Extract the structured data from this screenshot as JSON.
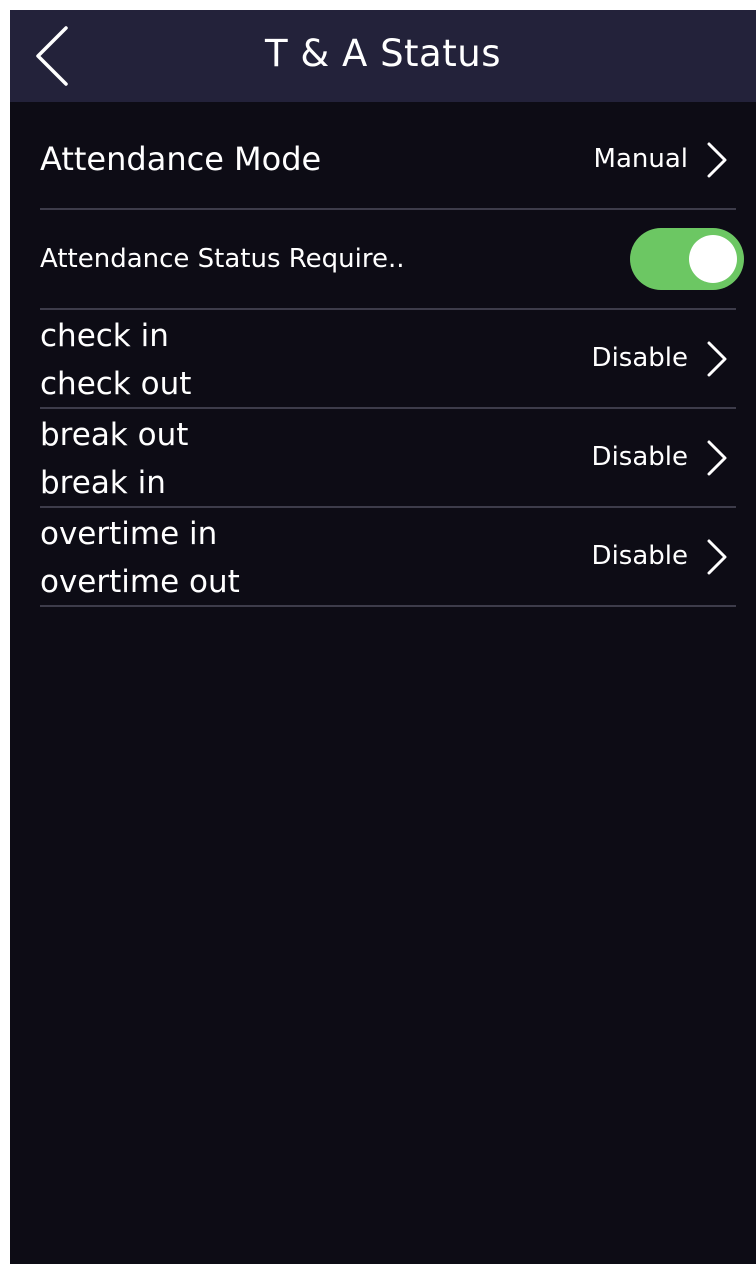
{
  "header": {
    "title": "T & A Status",
    "back_icon": "chevron-left-icon"
  },
  "settings": {
    "attendance_mode": {
      "label": "Attendance Mode",
      "value": "Manual"
    },
    "status_required": {
      "label": "Attendance Status Require..",
      "enabled": true
    },
    "status_rows": [
      {
        "line1": "check in",
        "line2": "check out",
        "value": "Disable"
      },
      {
        "line1": "break out",
        "line2": "break in",
        "value": "Disable"
      },
      {
        "line1": "overtime in",
        "line2": "overtime out",
        "value": "Disable"
      }
    ]
  },
  "colors": {
    "background": "#0d0c15",
    "header": "#23223a",
    "divider": "#3d3c4a",
    "toggle_on": "#6cc763"
  }
}
